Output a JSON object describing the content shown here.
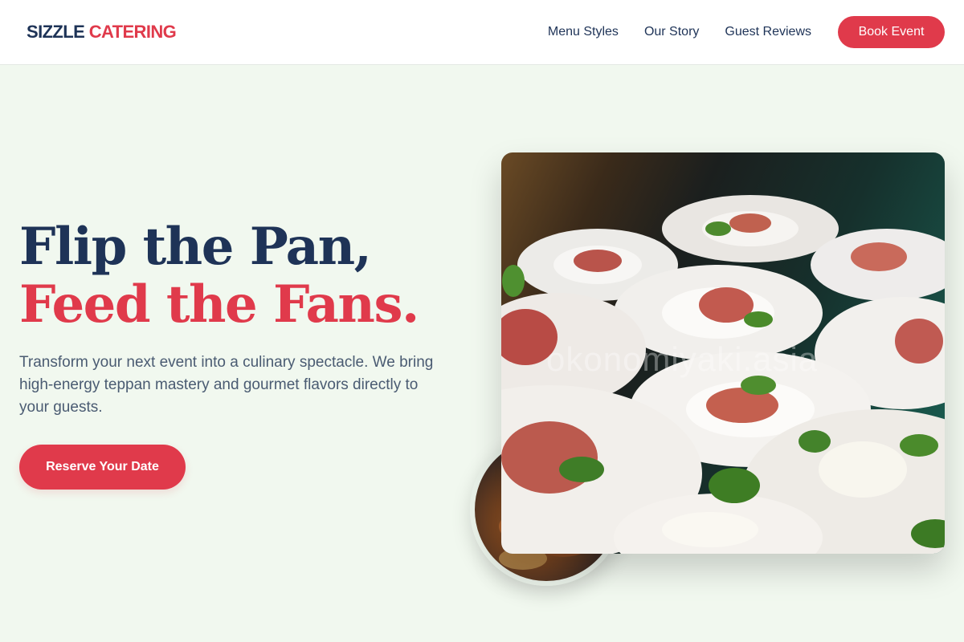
{
  "header": {
    "logo_part1": "SIZZLE",
    "logo_part2": "CATERING",
    "nav": [
      {
        "label": "Menu Styles"
      },
      {
        "label": "Our Story"
      },
      {
        "label": "Guest Reviews"
      }
    ],
    "cta_label": "Book Event"
  },
  "hero": {
    "title_line1": "Flip the Pan,",
    "title_line2": "Feed the Fans.",
    "description": "Transform your next event into a culinary spectacle. We bring high-energy teppan mastery and gourmet flavors directly to your guests.",
    "cta_label": "Reserve Your Date",
    "watermark": "okonomiyaki.asia"
  },
  "colors": {
    "navy": "#1e3357",
    "accent": "#e03a4b",
    "background": "#f1f8ef"
  }
}
